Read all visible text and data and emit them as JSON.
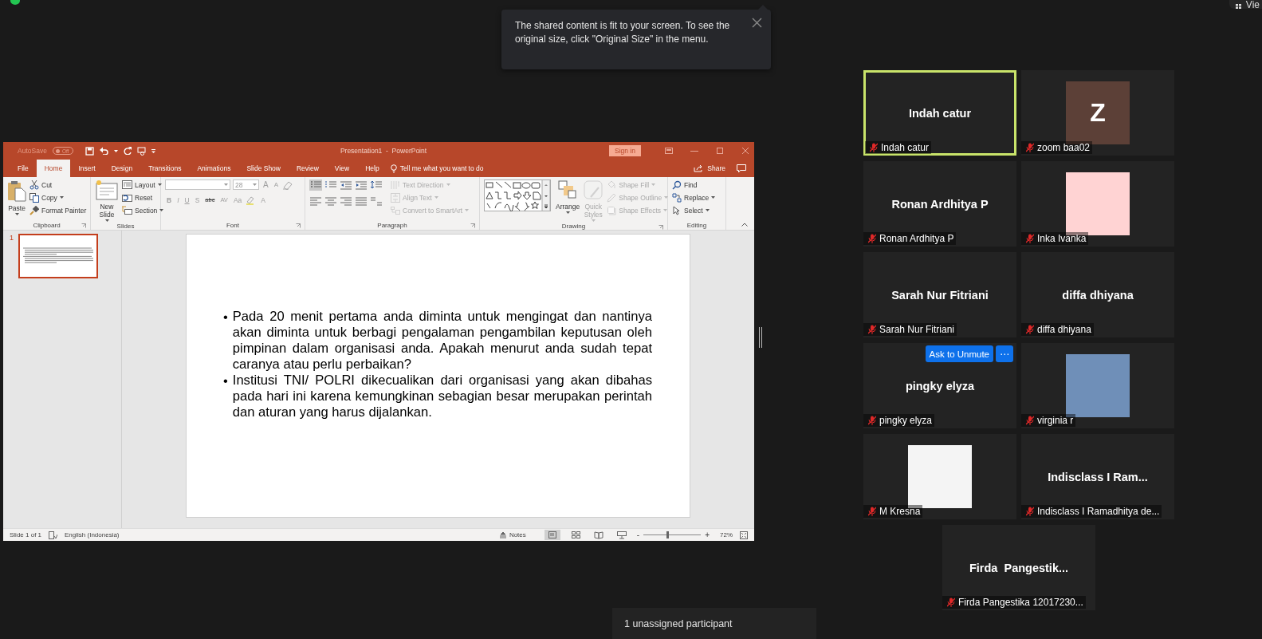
{
  "view_button": {
    "label": "Vie"
  },
  "notice": {
    "text": "The shared content is fit to your screen. To see the original size, click \"Original Size\" in the menu."
  },
  "presentation_window": {
    "autosave": {
      "label": "AutoSave",
      "state": "Off",
      "on": false
    },
    "title": "Presentation1  -  PowerPoint",
    "sign_in": "Sign in",
    "tabs": [
      {
        "label": "File",
        "selected": false
      },
      {
        "label": "Home",
        "selected": true
      },
      {
        "label": "Insert",
        "selected": false
      },
      {
        "label": "Design",
        "selected": false
      },
      {
        "label": "Transitions",
        "selected": false
      },
      {
        "label": "Animations",
        "selected": false
      },
      {
        "label": "Slide Show",
        "selected": false
      },
      {
        "label": "Review",
        "selected": false
      },
      {
        "label": "View",
        "selected": false
      },
      {
        "label": "Help",
        "selected": false
      }
    ],
    "tell_me": "Tell me what you want to do",
    "share": "Share",
    "ribbon_groups": [
      {
        "name": "Clipboard",
        "kind": "commands",
        "launcher": true,
        "items": [
          {
            "label": "Paste",
            "kind": "large",
            "has_menu": true,
            "disabled": false
          },
          {
            "label": "Cut",
            "kind": "small",
            "has_menu": false,
            "disabled": false
          },
          {
            "label": "Copy",
            "kind": "small",
            "has_menu": true,
            "disabled": false
          },
          {
            "label": "Format Painter",
            "kind": "small",
            "has_menu": false,
            "disabled": false
          }
        ]
      },
      {
        "name": "Slides",
        "kind": "commands",
        "launcher": false,
        "items": [
          {
            "label": "New Slide",
            "kind": "large",
            "has_menu": true,
            "disabled": false
          },
          {
            "label": "Layout",
            "kind": "small",
            "has_menu": true,
            "disabled": false
          },
          {
            "label": "Reset",
            "kind": "small",
            "has_menu": false,
            "disabled": false
          },
          {
            "label": "Section",
            "kind": "small",
            "has_menu": true,
            "disabled": false
          }
        ]
      },
      {
        "name": "Font",
        "kind": "font",
        "launcher": true,
        "size_value": "28",
        "top_buttons": [
          "A",
          "A"
        ],
        "bottom_buttons": [
          "B",
          "I",
          "U",
          "S",
          "abc",
          "AV",
          "Aa",
          "A"
        ]
      },
      {
        "name": "Paragraph",
        "kind": "paragraph",
        "launcher": true,
        "bullets_on": true,
        "items": [
          {
            "label": "Text Direction",
            "kind": "small",
            "has_menu": true,
            "disabled": true
          },
          {
            "label": "Align Text",
            "kind": "small",
            "has_menu": true,
            "disabled": true
          },
          {
            "label": "Convert to SmartArt",
            "kind": "small",
            "has_menu": true,
            "disabled": true
          }
        ]
      },
      {
        "name": "Drawing",
        "kind": "drawing",
        "launcher": true,
        "items": [
          {
            "label": "Arrange",
            "kind": "large",
            "has_menu": true,
            "disabled": false
          },
          {
            "label": "Quick Styles",
            "kind": "large",
            "has_menu": true,
            "disabled": true
          },
          {
            "label": "Shape Fill",
            "kind": "small",
            "has_menu": true,
            "disabled": true
          },
          {
            "label": "Shape Outline",
            "kind": "small",
            "has_menu": true,
            "disabled": true
          },
          {
            "label": "Shape Effects",
            "kind": "small",
            "has_menu": true,
            "disabled": true
          }
        ]
      },
      {
        "name": "Editing",
        "kind": "commands",
        "launcher": false,
        "items": [
          {
            "label": "Find",
            "kind": "small",
            "has_menu": false,
            "disabled": false
          },
          {
            "label": "Replace",
            "kind": "small",
            "has_menu": true,
            "disabled": false
          },
          {
            "label": "Select",
            "kind": "small",
            "has_menu": true,
            "disabled": false
          }
        ]
      }
    ],
    "thumbnails": [
      {
        "number": "1",
        "selected": true
      }
    ],
    "slide_bullets": [
      {
        "mark": "•",
        "text": "Pada 20 menit pertama anda diminta untuk mengingat dan nantinya akan diminta untuk berbagi pengalaman pengambilan keputusan oleh pimpinan dalam organisasi anda. Apakah menurut anda sudah tepat caranya atau perlu perbaikan?"
      },
      {
        "mark": "•",
        "text": "Institusi TNI/ POLRI dikecualikan dari organisasi yang akan dibahas pada hari ini karena kemungkinan sebagian besar merupakan perintah dan aturan yang harus dijalankan."
      }
    ],
    "status_bar": {
      "slide": "Slide 1 of 1",
      "language": "English (Indonesia)",
      "notes": "Notes",
      "views": [
        {
          "selected": true
        },
        {
          "selected": false
        },
        {
          "selected": false
        },
        {
          "selected": false
        }
      ],
      "zoom_out": "-",
      "zoom_in": "+",
      "zoom": {
        "level": 0.42
      },
      "zoom_reading": "72%"
    }
  },
  "participants": [
    {
      "name": "Indah catur",
      "label": "Indah catur",
      "kind": "name",
      "muted": true,
      "active": true
    },
    {
      "label": "zoom baa02",
      "kind": "avatar",
      "initial": "Z",
      "color": "#5c4037",
      "muted": true,
      "active": false
    },
    {
      "name": "Ronan Ardhitya P",
      "label": "Ronan Ardhitya P",
      "kind": "name",
      "muted": true,
      "active": false
    },
    {
      "label": "Inka Ivanka",
      "kind": "photo",
      "color": "#ffd3d3",
      "muted": true,
      "active": false
    },
    {
      "name": "Sarah Nur Fitriani",
      "label": "Sarah Nur Fitriani",
      "kind": "name",
      "muted": true,
      "active": false
    },
    {
      "name": "diffa dhiyana",
      "label": "diffa dhiyana",
      "kind": "name",
      "muted": true,
      "active": false
    },
    {
      "name": "pingky elyza",
      "label": "pingky elyza",
      "kind": "name",
      "muted": true,
      "active": false,
      "actions": {
        "unmute": "Ask to Unmute",
        "more": "⋯"
      }
    },
    {
      "label": "virginia r",
      "kind": "photo",
      "color": "#6f8fb8",
      "muted": true,
      "active": false
    },
    {
      "label": "M Kresna",
      "kind": "photo",
      "color": "#f4f4f4",
      "muted": true,
      "active": false
    },
    {
      "name": "Indisclass I Ram...",
      "label": "Indisclass I Ramadhitya de...",
      "kind": "name",
      "muted": true,
      "active": false
    },
    {
      "name": "Firda  Pangestik...",
      "label": "Firda Pangestika 12017230...",
      "kind": "name",
      "muted": true,
      "active": false
    }
  ],
  "unassigned": {
    "text": "1 unassigned participant"
  }
}
